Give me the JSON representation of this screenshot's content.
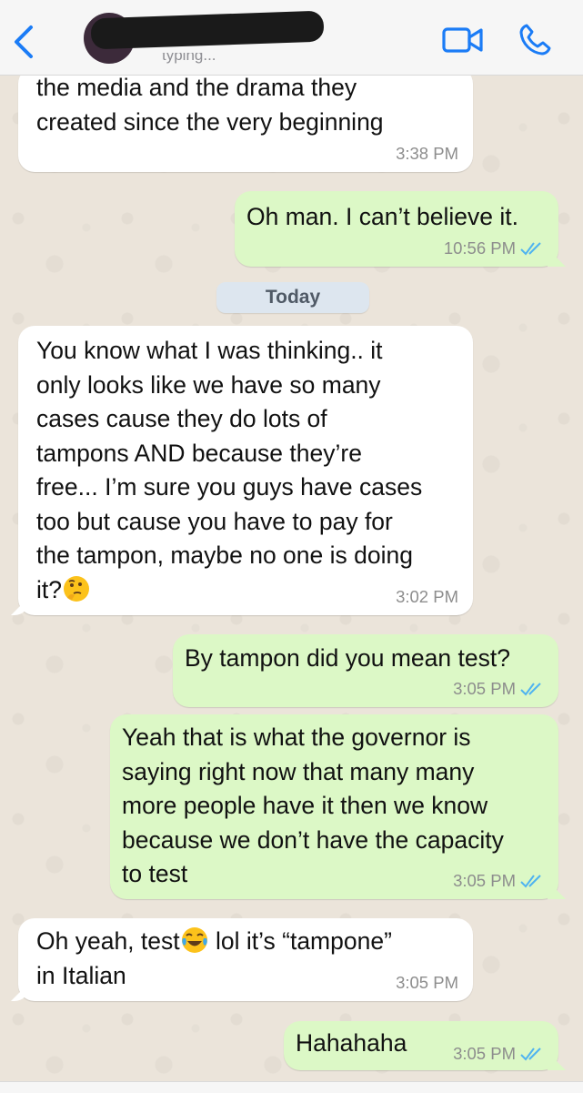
{
  "header": {
    "contact_name": "",
    "status": "typing...",
    "colors": {
      "accent": "#1b7cf6"
    },
    "icons": {
      "back": "chevron-left-icon",
      "video": "video-camera-icon",
      "call": "phone-icon"
    }
  },
  "date_separator": "Today",
  "messages": [
    {
      "direction": "incoming",
      "lines": "the media and the drama they\ncreated since the very beginning",
      "time": "3:38 PM"
    },
    {
      "direction": "outgoing",
      "lines": "Oh man. I can’t believe it.",
      "time": "10:56 PM",
      "status": "read"
    },
    {
      "direction": "incoming",
      "lines": "You know what I was thinking.. it\nonly looks like we have so many\ncases cause they do lots of\ntampons AND because they’re\nfree... I’m sure you guys have cases\ntoo but cause you have to pay for\nthe tampon, maybe no one is doing\nit?",
      "emoji": "thinking-face",
      "time": "3:02 PM"
    },
    {
      "direction": "outgoing",
      "lines": "By tampon did you mean test?",
      "time": "3:05 PM",
      "status": "read"
    },
    {
      "direction": "outgoing",
      "lines": "Yeah that is what the governor is\nsaying right now that many many\nmore people have it then we know\nbecause we don’t have the capacity\nto test",
      "time": "3:05 PM",
      "status": "read"
    },
    {
      "direction": "incoming",
      "lines_a": "Oh yeah, test",
      "emoji": "face-with-tears-of-joy",
      "lines_b": " lol it’s “tampone”\nin Italian",
      "time": "3:05 PM"
    },
    {
      "direction": "outgoing",
      "lines": "Hahahaha",
      "time": "3:05 PM",
      "status": "read"
    }
  ]
}
